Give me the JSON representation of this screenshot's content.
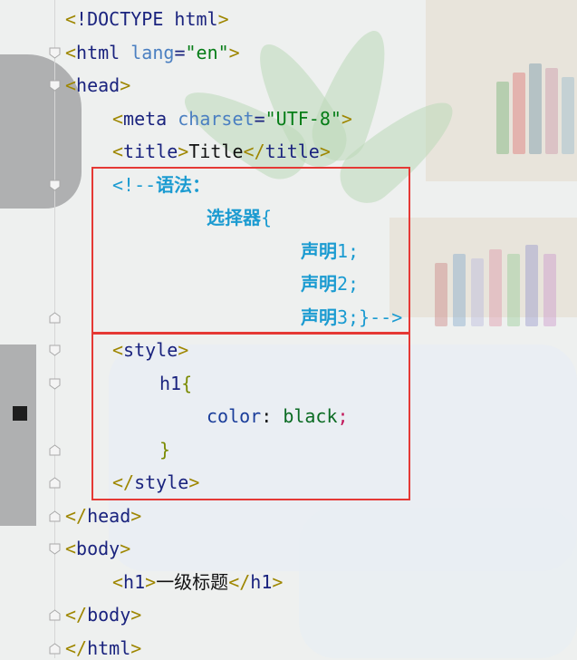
{
  "editor": {
    "lines": [
      {
        "indent": 0,
        "parts": [
          {
            "c": "brk",
            "t": "<"
          },
          {
            "c": "tag",
            "t": "!DOCTYPE html"
          },
          {
            "c": "brk",
            "t": ">"
          }
        ]
      },
      {
        "indent": 0,
        "parts": [
          {
            "c": "brk",
            "t": "<"
          },
          {
            "c": "tag",
            "t": "html "
          },
          {
            "c": "attr",
            "t": "lang"
          },
          {
            "c": "tag",
            "t": "="
          },
          {
            "c": "str",
            "t": "\"en\""
          },
          {
            "c": "brk",
            "t": ">"
          }
        ]
      },
      {
        "indent": 0,
        "parts": [
          {
            "c": "brk",
            "t": "<"
          },
          {
            "c": "tag",
            "t": "head"
          },
          {
            "c": "brk",
            "t": ">"
          }
        ]
      },
      {
        "indent": 1,
        "parts": [
          {
            "c": "brk",
            "t": "<"
          },
          {
            "c": "tag",
            "t": "meta "
          },
          {
            "c": "attr",
            "t": "charset"
          },
          {
            "c": "tag",
            "t": "="
          },
          {
            "c": "str",
            "t": "\"UTF-8\""
          },
          {
            "c": "brk",
            "t": ">"
          }
        ]
      },
      {
        "indent": 1,
        "parts": [
          {
            "c": "brk",
            "t": "<"
          },
          {
            "c": "tag",
            "t": "title"
          },
          {
            "c": "brk",
            "t": ">"
          },
          {
            "c": "txt",
            "t": "Title"
          },
          {
            "c": "brk",
            "t": "</"
          },
          {
            "c": "tag",
            "t": "title"
          },
          {
            "c": "brk",
            "t": ">"
          }
        ]
      },
      {
        "indent": 1,
        "parts": [
          {
            "c": "cmt",
            "t": "<!--"
          },
          {
            "c": "cmtcn",
            "t": "语法："
          }
        ]
      },
      {
        "indent": 3,
        "parts": [
          {
            "c": "cmtcn",
            "t": "选择器"
          },
          {
            "c": "cmt",
            "t": "{"
          }
        ]
      },
      {
        "indent": 5,
        "parts": [
          {
            "c": "cmtcn",
            "t": "声明"
          },
          {
            "c": "cmt",
            "t": "1;"
          }
        ]
      },
      {
        "indent": 5,
        "parts": [
          {
            "c": "cmtcn",
            "t": "声明"
          },
          {
            "c": "cmt",
            "t": "2;"
          }
        ]
      },
      {
        "indent": 5,
        "parts": [
          {
            "c": "cmtcn",
            "t": "声明"
          },
          {
            "c": "cmt",
            "t": "3;}-->"
          }
        ]
      },
      {
        "indent": 1,
        "parts": [
          {
            "c": "brk",
            "t": "<"
          },
          {
            "c": "tag",
            "t": "style"
          },
          {
            "c": "brk",
            "t": ">"
          }
        ]
      },
      {
        "indent": 2,
        "parts": [
          {
            "c": "sel",
            "t": "h1"
          },
          {
            "c": "brace",
            "t": "{"
          }
        ]
      },
      {
        "indent": 3,
        "parts": [
          {
            "c": "prop",
            "t": "color"
          },
          {
            "c": "txt",
            "t": ": "
          },
          {
            "c": "val",
            "t": "black"
          },
          {
            "c": "semi",
            "t": ";"
          }
        ]
      },
      {
        "indent": 2,
        "parts": [
          {
            "c": "brace",
            "t": "}"
          }
        ]
      },
      {
        "indent": 1,
        "parts": [
          {
            "c": "brk",
            "t": "</"
          },
          {
            "c": "tag",
            "t": "style"
          },
          {
            "c": "brk",
            "t": ">"
          }
        ]
      },
      {
        "indent": 0,
        "parts": [
          {
            "c": "brk",
            "t": "</"
          },
          {
            "c": "tag",
            "t": "head"
          },
          {
            "c": "brk",
            "t": ">"
          }
        ]
      },
      {
        "indent": 0,
        "parts": [
          {
            "c": "brk",
            "t": "<"
          },
          {
            "c": "tag",
            "t": "body"
          },
          {
            "c": "brk",
            "t": ">"
          }
        ]
      },
      {
        "indent": 1,
        "parts": [
          {
            "c": "brk",
            "t": "<"
          },
          {
            "c": "tag",
            "t": "h1"
          },
          {
            "c": "brk",
            "t": ">"
          },
          {
            "c": "txt cn",
            "t": "一级标题"
          },
          {
            "c": "brk",
            "t": "</"
          },
          {
            "c": "tag",
            "t": "h1"
          },
          {
            "c": "brk",
            "t": ">"
          }
        ]
      },
      {
        "indent": 0,
        "parts": [
          {
            "c": "brk",
            "t": "</"
          },
          {
            "c": "tag",
            "t": "body"
          },
          {
            "c": "brk",
            "t": ">"
          }
        ]
      },
      {
        "indent": 0,
        "parts": [
          {
            "c": "brk",
            "t": "</"
          },
          {
            "c": "tag",
            "t": "html"
          },
          {
            "c": "brk",
            "t": ">"
          }
        ]
      }
    ],
    "fold_markers": [
      {
        "line": 1,
        "kind": "open"
      },
      {
        "line": 2,
        "kind": "open"
      },
      {
        "line": 5,
        "kind": "open"
      },
      {
        "line": 9,
        "kind": "close"
      },
      {
        "line": 10,
        "kind": "open"
      },
      {
        "line": 11,
        "kind": "open"
      },
      {
        "line": 13,
        "kind": "close"
      },
      {
        "line": 14,
        "kind": "close"
      },
      {
        "line": 15,
        "kind": "close"
      },
      {
        "line": 16,
        "kind": "open"
      },
      {
        "line": 18,
        "kind": "close"
      },
      {
        "line": 19,
        "kind": "close"
      }
    ],
    "breakpoint_line": 12,
    "highlight_boxes": [
      {
        "from_line": 5,
        "to_line": 9,
        "label": "comment-syntax-box"
      },
      {
        "from_line": 10,
        "to_line": 14,
        "label": "style-block-box"
      }
    ],
    "colors": {
      "tag": "#1a237e",
      "bracket": "#9e8600",
      "attribute": "#4a7fc1",
      "string": "#067d17",
      "comment": "#1b9bd1",
      "highlight_border": "#e53935"
    }
  }
}
